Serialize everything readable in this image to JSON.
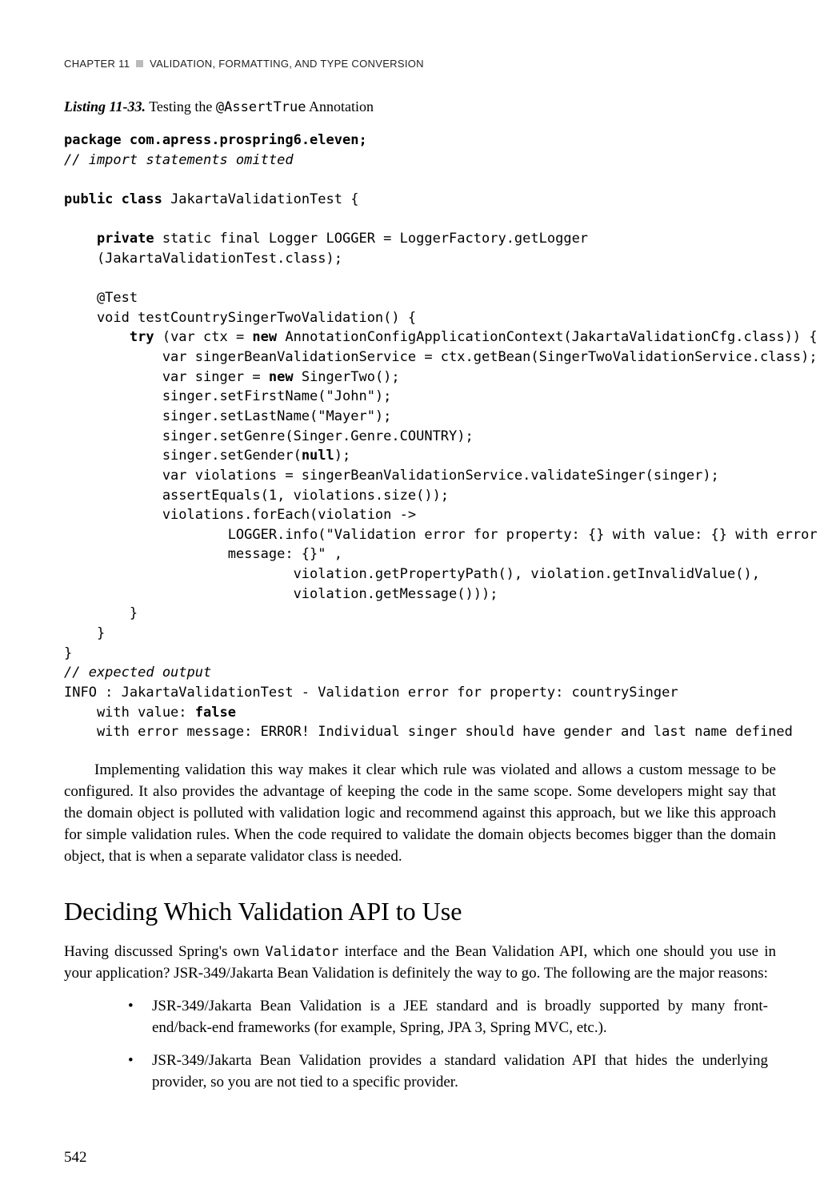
{
  "header": {
    "chapter_prefix": "CHAPTER 11",
    "chapter_title": "VALIDATION, FORMATTING, AND TYPE CONVERSION"
  },
  "listing": {
    "number": "Listing 11-33.",
    "caption_prefix": "  Testing the ",
    "caption_code": "@AssertTrue",
    "caption_suffix": " Annotation"
  },
  "code": {
    "line1a": "package",
    "line1b": " com.apress.prospring6.eleven;",
    "line2": "// import statements omitted",
    "line3a": "public class",
    "line3b": " JakartaValidationTest {",
    "line4a": "    private",
    "line4b": " static final Logger LOGGER = LoggerFactory.getLogger",
    "line4c": "    (JakartaValidationTest.class);",
    "line5": "    @Test",
    "line6": "    void testCountrySingerTwoValidation() {",
    "line7a": "        try",
    "line7b": " (var ctx = ",
    "line7c": "new",
    "line7d": " AnnotationConfigApplicationContext(JakartaValidationCfg.class)) {",
    "line8": "            var singerBeanValidationService = ctx.getBean(SingerTwoValidationService.class);",
    "line9a": "            var singer = ",
    "line9b": "new",
    "line9c": " SingerTwo();",
    "line10": "            singer.setFirstName(\"John\");",
    "line11": "            singer.setLastName(\"Mayer\");",
    "line12": "            singer.setGenre(Singer.Genre.COUNTRY);",
    "line13a": "            singer.setGender(",
    "line13b": "null",
    "line13c": ");",
    "line14": "            var violations = singerBeanValidationService.validateSinger(singer);",
    "line15": "            assertEquals(1, violations.size());",
    "line16": "            violations.forEach(violation ->",
    "line17": "                    LOGGER.info(\"Validation error for property: {} with value: {} with error ",
    "line17b": "                    message: {}\" ,",
    "line18": "                            violation.getPropertyPath(), violation.getInvalidValue(), ",
    "line18b": "                            violation.getMessage()));",
    "line19": "        }",
    "line20": "    }",
    "line21": "}",
    "line22": "// expected output",
    "line23": "INFO : JakartaValidationTest - Validation error for property: countrySinger",
    "line24a": "    with value: ",
    "line24b": "false",
    "line25": "    with error message: ERROR! Individual singer should have gender and last name defined"
  },
  "para1": "Implementing validation this way makes it clear which rule was violated and allows a custom message to be configured. It also provides the advantage of keeping the code in the same scope. Some developers might say that the domain object is polluted with validation logic and recommend against this approach, but we like this approach for simple validation rules. When the code required to validate the domain objects becomes bigger than the domain object, that is when a separate validator class is needed.",
  "section": {
    "title": "Deciding Which Validation API to Use",
    "intro_a": "Having discussed Spring's own ",
    "intro_code": "Validator",
    "intro_b": " interface and the Bean Validation API, which one should you use in your application? JSR-349/Jakarta Bean Validation is definitely the way to go. The following are the major reasons:",
    "bullets": [
      "JSR-349/Jakarta Bean Validation is a JEE standard and is broadly supported by many front-end/back-end frameworks (for example, Spring, JPA 3, Spring MVC, etc.).",
      "JSR-349/Jakarta Bean Validation provides a standard validation API that hides the underlying provider, so you are not tied to a specific provider."
    ]
  },
  "page_number": "542"
}
